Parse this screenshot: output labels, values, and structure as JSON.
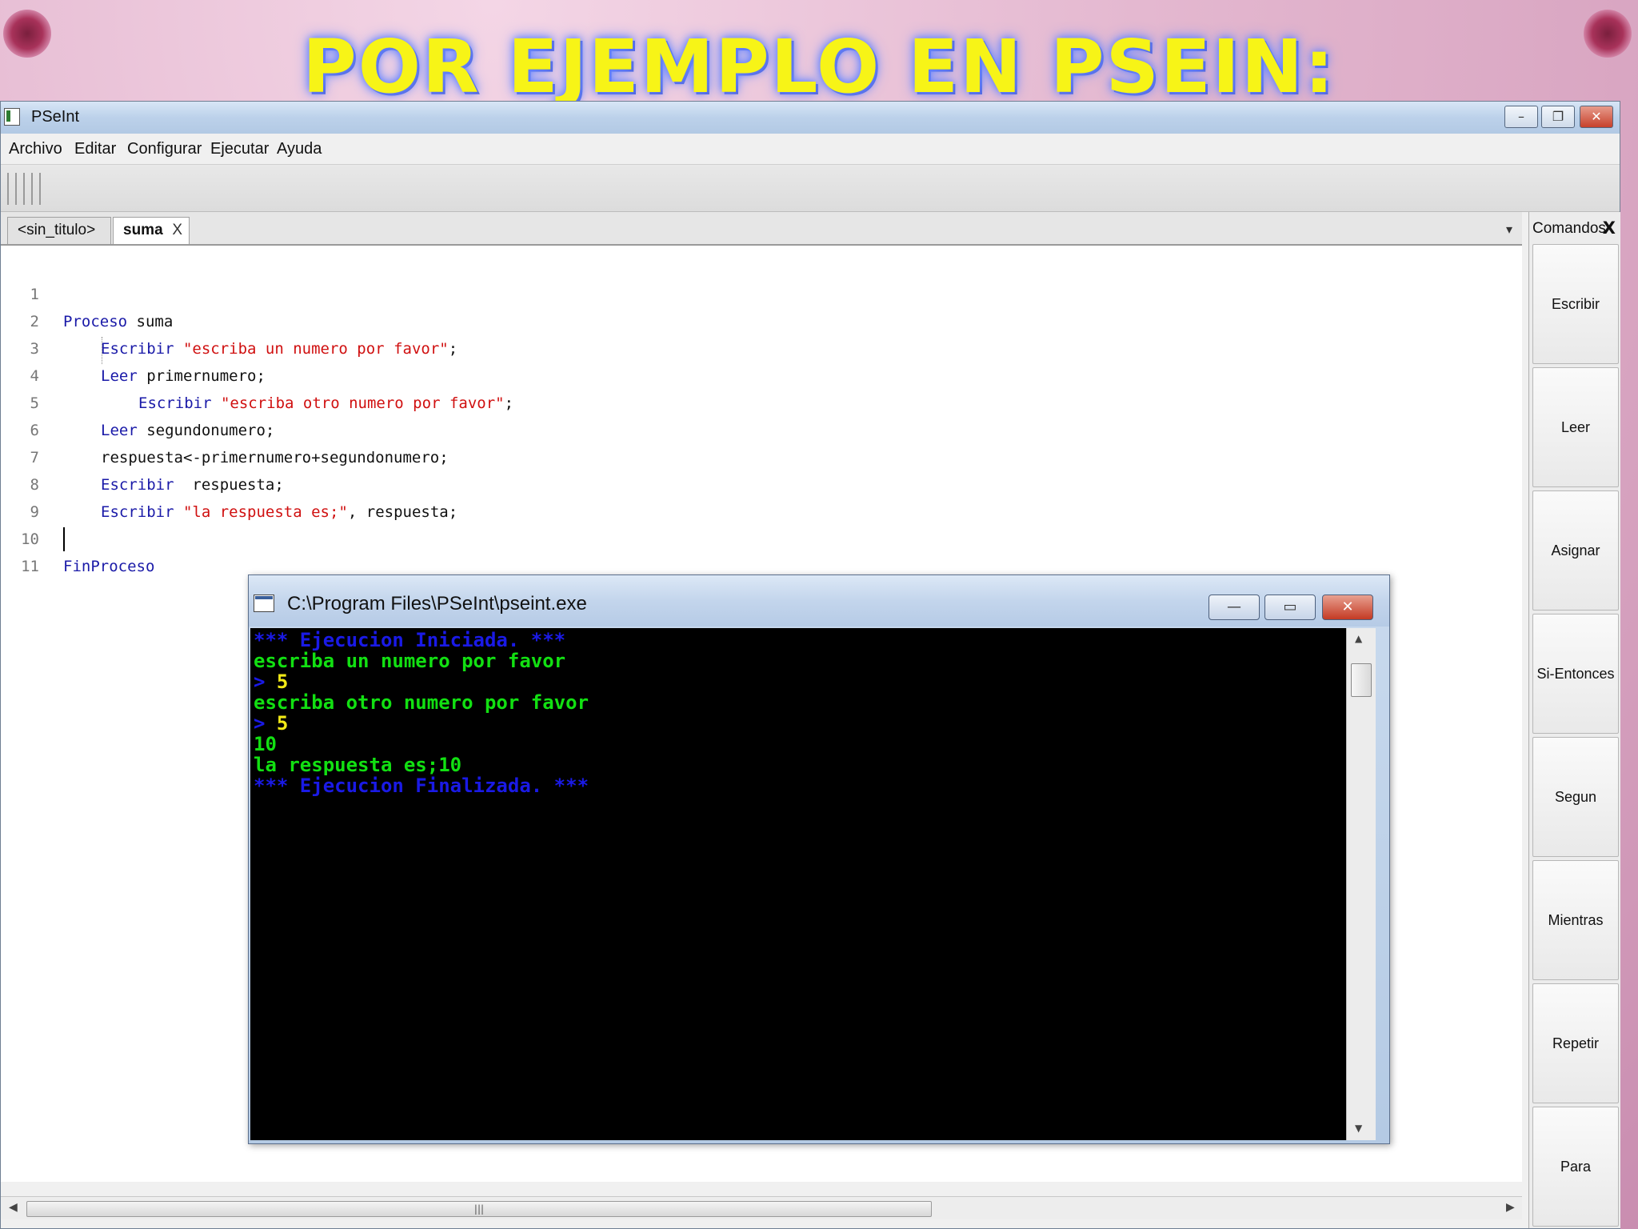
{
  "slide": {
    "title": "POR EJEMPLO EN PSEIN:"
  },
  "window": {
    "title": "PSeInt",
    "controls": {
      "minimize": "–",
      "restore": "❐",
      "close": "✕"
    }
  },
  "menu": [
    "Archivo",
    "Editar",
    "Configurar",
    "Ejecutar",
    "Ayuda"
  ],
  "tabs": [
    {
      "label": "<sin_titulo>",
      "active": false
    },
    {
      "label": "suma",
      "active": true,
      "close": "X"
    }
  ],
  "tab_dropdown": "▾",
  "editor": {
    "lines": [
      {
        "n": "1",
        "kw": "Proceso",
        "rest": " suma",
        "str": "",
        "tail": ""
      },
      {
        "n": "2",
        "kw": "Escribir",
        "rest": " ",
        "str": "\"escriba un numero por favor\"",
        "tail": ";"
      },
      {
        "n": "3",
        "kw": "Leer",
        "rest": " primernumero;",
        "str": "",
        "tail": ""
      },
      {
        "n": "4",
        "kw": "Escribir",
        "rest": " ",
        "str": "\"escriba otro numero por favor\"",
        "tail": ";"
      },
      {
        "n": "5",
        "kw": "Leer",
        "rest": " segundonumero;",
        "str": "",
        "tail": ""
      },
      {
        "n": "6",
        "kw": "",
        "rest": "respuesta<-primernumero+segundonumero;",
        "str": "",
        "tail": ""
      },
      {
        "n": "7",
        "kw": "Escribir",
        "rest": "  respuesta;",
        "str": "",
        "tail": ""
      },
      {
        "n": "8",
        "kw": "Escribir",
        "rest": " ",
        "str": "\"la respuesta es;\"",
        "tail": ", respuesta;"
      },
      {
        "n": "9",
        "kw": "",
        "rest": "",
        "str": "",
        "tail": ""
      },
      {
        "n": "10",
        "kw": "FinProceso",
        "rest": "",
        "str": "",
        "tail": ""
      },
      {
        "n": "11",
        "kw": "",
        "rest": "",
        "str": "",
        "tail": ""
      }
    ]
  },
  "commands": {
    "header": "Comandos",
    "close": "X",
    "buttons": [
      "Escribir",
      "Leer",
      "Asignar",
      "Si-Entonces",
      "Segun",
      "Mientras",
      "Repetir",
      "Para"
    ]
  },
  "console": {
    "title": "C:\\Program Files\\PSeInt\\pseint.exe",
    "controls": {
      "minimize": "—",
      "restore": "▭",
      "close": "✕"
    },
    "lines": [
      {
        "text": "*** Ejecucion Iniciada. ***",
        "color": "blue"
      },
      {
        "text": "escriba un numero por favor",
        "color": "green"
      },
      {
        "prompt": "> ",
        "text": "5",
        "color": "yellow"
      },
      {
        "text": "escriba otro numero por favor",
        "color": "green"
      },
      {
        "prompt": "> ",
        "text": "5",
        "color": "yellow"
      },
      {
        "text": "10",
        "color": "green"
      },
      {
        "text": "la respuesta es;10",
        "color": "green"
      },
      {
        "text": "*** Ejecucion Finalizada. ***",
        "color": "blue"
      }
    ],
    "scroll_up": "▲",
    "scroll_down": "▼"
  },
  "hscroll": {
    "left": "◀",
    "right": "▶",
    "grip": "|||"
  },
  "colors": {
    "keyword": "#1a1aa8",
    "string": "#d01010",
    "console_blue": "#1a1ae6",
    "console_green": "#12e012",
    "console_yellow": "#f2ea16",
    "title_yellow": "#f7f417"
  }
}
